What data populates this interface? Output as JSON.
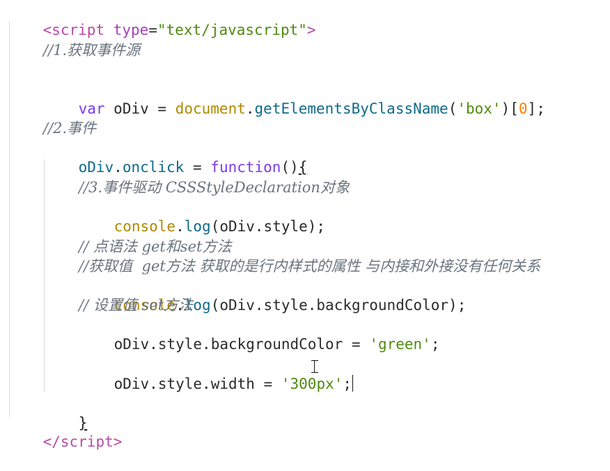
{
  "code": {
    "open_tag_lt": "<",
    "open_tag_name": "script",
    "open_tag_attr": "type",
    "open_tag_eq": "=",
    "open_tag_value": "\"text/javascript\"",
    "open_tag_gt": ">",
    "comment_1": "//1.获取事件源",
    "var_kw": "var",
    "var_name": "oDiv",
    "var_eq": "=",
    "document": "document",
    "method_get": "getElementsByClassName",
    "paren_open": "(",
    "box_string": "'box'",
    "paren_close": ")",
    "index_open": "[",
    "index_value": "0",
    "index_close": "]",
    "semicolon": ";",
    "comment_2": "//2.事件",
    "onclick_obj": "oDiv",
    "onclick_dot": ".",
    "onclick_prop": "onclick",
    "onclick_eq": "=",
    "function_kw": "function",
    "function_parens": "()",
    "brace_open": "{",
    "comment_3": "//3.事件驱动 CSSStyleDeclaration对象",
    "console_1": "console",
    "log_1": "log",
    "log_1_arg": "(oDiv.style)",
    "log_1_end": ";",
    "comment_4": "// 点语法 get和set方法",
    "comment_5": "//获取值  get方法 获取的是行内样式的属性 与内接和外接没有任何关系",
    "console_2": "console",
    "log_2": "log",
    "log_2_arg": "(oDiv.style.backgroundColor)",
    "log_2_end": ";",
    "comment_6": "// 设置值 set方法",
    "set_bg_obj": "oDiv",
    "set_bg_style": "style",
    "set_bg_prop": "backgroundColor",
    "set_bg_eq": "=",
    "green_string": "'green'",
    "set_bg_end": ";",
    "set_width_obj": "oDiv",
    "set_width_style": "style",
    "set_width_prop": "width",
    "set_width_eq": "=",
    "width_string": "'300px'",
    "set_width_end": ";",
    "brace_close": "}",
    "close_tag_lt": "</",
    "close_tag_name": "script",
    "close_tag_gt": ">"
  },
  "colors": {
    "tag": "#b84aa4",
    "attribute": "#a83fbb",
    "string": "#4f8a10",
    "keyword": "#7c3aed",
    "method": "#0f6a8a",
    "global": "#b08900",
    "number": "#ff7f00",
    "comment": "#6a737d"
  }
}
